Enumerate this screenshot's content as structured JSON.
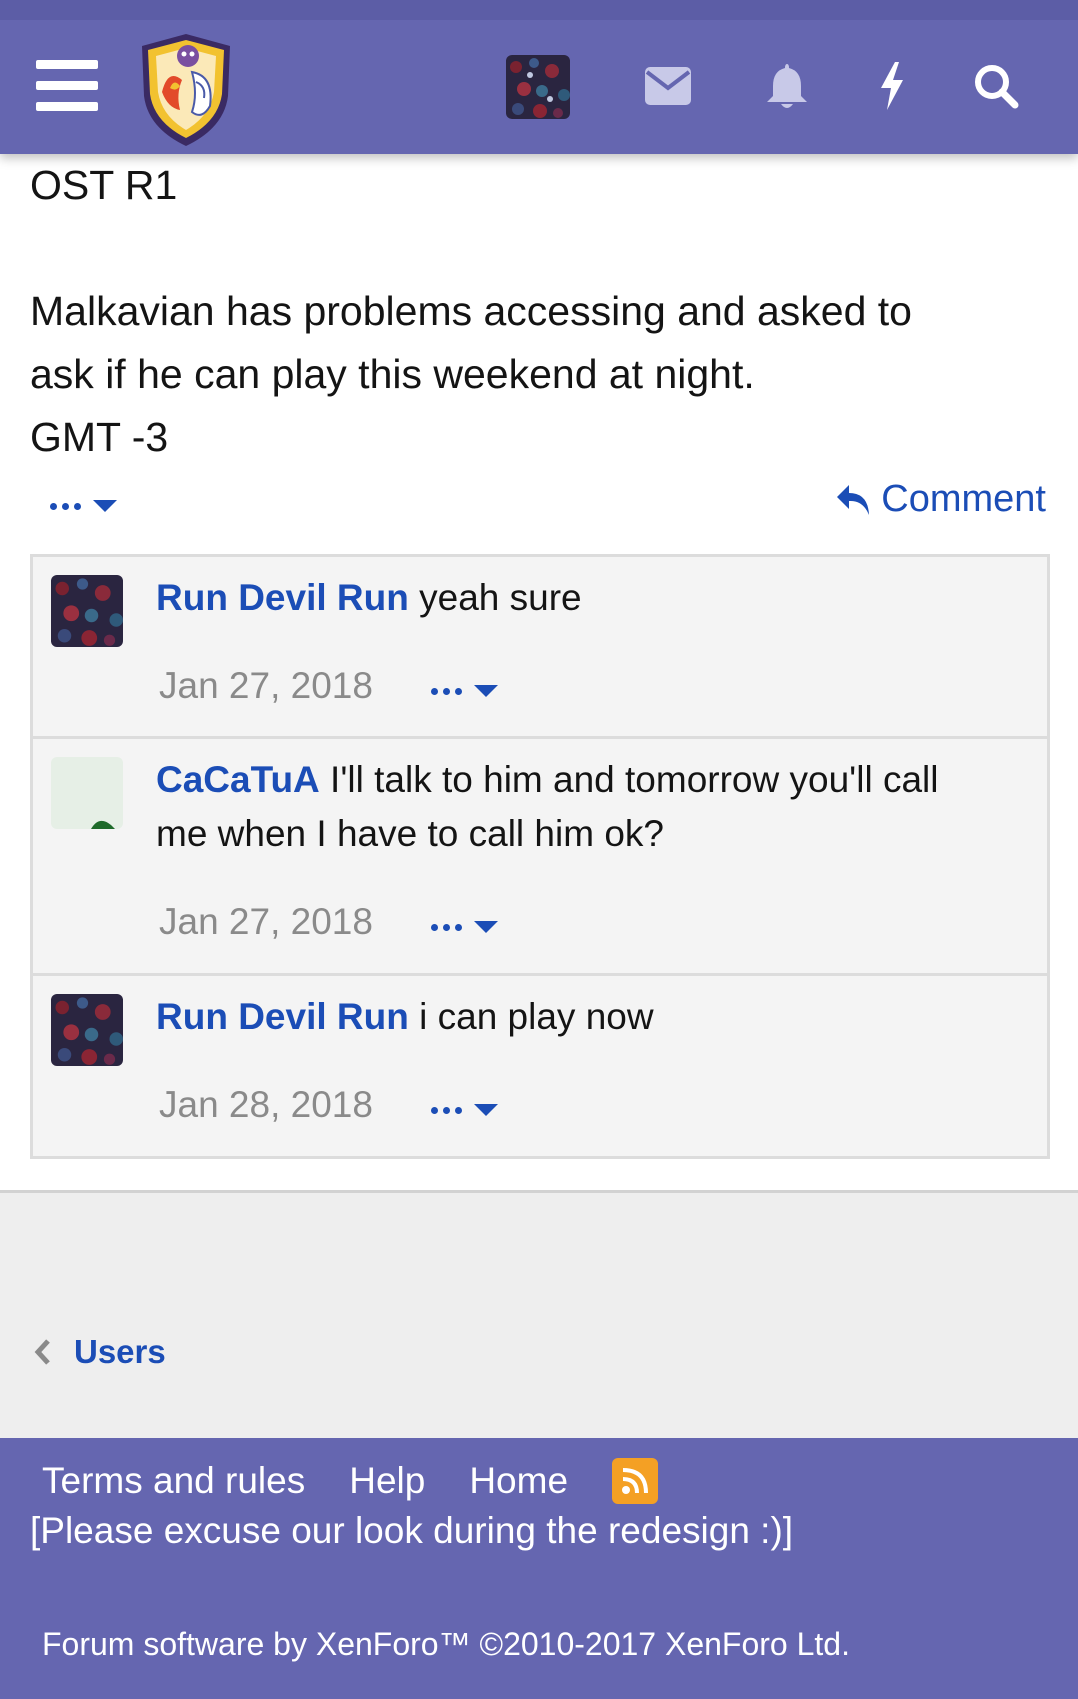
{
  "header": {
    "menu_icon": "hamburger-icon",
    "nav_icons": [
      "envelope-icon",
      "bell-icon",
      "bolt-icon",
      "search-icon"
    ],
    "brand_color": "#6566b0"
  },
  "post": {
    "lines": [
      "OST R1",
      "",
      "Malkavian has problems accessing and asked to",
      "ask if he can play this weekend at night.",
      "GMT -3"
    ],
    "comment_label": "Comment"
  },
  "comments": [
    {
      "author": "Run Devil Run",
      "text": " yeah sure",
      "date": "Jan 27, 2018"
    },
    {
      "author": "CaCaTuA",
      "text": " I'll talk to him and tomorrow you'll call",
      "text2": "me when I have to call him ok?",
      "date": "Jan 27, 2018"
    },
    {
      "author": "Run Devil Run",
      "text": " i can play now",
      "date": "Jan 28, 2018"
    }
  ],
  "breadcrumb": {
    "label": "Users"
  },
  "footer": {
    "links": [
      "Terms and rules",
      "Help",
      "Home"
    ],
    "note": "[Please excuse our look during the redesign :)]",
    "copyright": "Forum software by XenForo™ ©2010-2017 XenForo Ltd."
  },
  "link_color": "#1b4db6"
}
